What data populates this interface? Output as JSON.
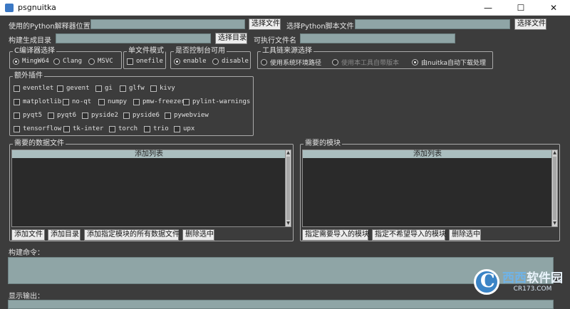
{
  "window": {
    "title": "psgnuitka",
    "controls": {
      "minimize": "—",
      "maximize": "☐",
      "close": "✕"
    }
  },
  "top": {
    "python_label": "使用的Python解释器位置",
    "python_value": "",
    "python_button": "选择文件",
    "script_label": "选择Python脚本文件",
    "script_value": "",
    "script_button": "选择文件",
    "outdir_label": "构建生成目录",
    "outdir_value": "",
    "outdir_button": "选择目录",
    "exe_label": "可执行文件名",
    "exe_value": ""
  },
  "compiler": {
    "title": "C编译器选择",
    "options": [
      "MingW64",
      "Clang",
      "MSVC"
    ],
    "selected": "MingW64"
  },
  "onefile": {
    "title": "单文件模式",
    "label": "onefile",
    "checked": false
  },
  "console": {
    "title": "是否控制台可用",
    "options": [
      "enable",
      "disable"
    ],
    "selected": "enable"
  },
  "toolchain": {
    "title": "工具链来源选择",
    "options": [
      "使用系统环境路径",
      "使用本工具自带版本",
      "由nuitka自动下载处理"
    ],
    "disabled": [
      "使用本工具自带版本"
    ],
    "selected": "由nuitka自动下载处理"
  },
  "plugins": {
    "title": "额外插件",
    "rows": [
      [
        "eventlet",
        "gevent",
        "gi",
        "glfw",
        "kivy"
      ],
      [
        "matplotlib",
        "no-qt",
        "numpy",
        "pmw-freezer",
        "pylint-warnings"
      ],
      [
        "pyqt5",
        "pyqt6",
        "pyside2",
        "pyside6",
        "pywebview"
      ],
      [
        "tensorflow",
        "tk-inter",
        "torch",
        "trio",
        "upx"
      ]
    ]
  },
  "datafiles": {
    "title": "需要的数据文件",
    "list_header": "添加列表",
    "buttons": [
      "添加文件",
      "添加目录",
      "添加指定模块的所有数据文件",
      "删除选中"
    ]
  },
  "modules": {
    "title": "需要的模块",
    "list_header": "添加列表",
    "buttons": [
      "指定需要导入的模块",
      "指定不希望导入的模块",
      "删除选中"
    ]
  },
  "build_cmd": {
    "label": "构建命令：",
    "value": ""
  },
  "output": {
    "label": "显示输出：",
    "value": ""
  },
  "watermark": {
    "logo": "C",
    "line1a": "西西",
    "line1b": "软件园",
    "line2": "CR173.COM"
  }
}
